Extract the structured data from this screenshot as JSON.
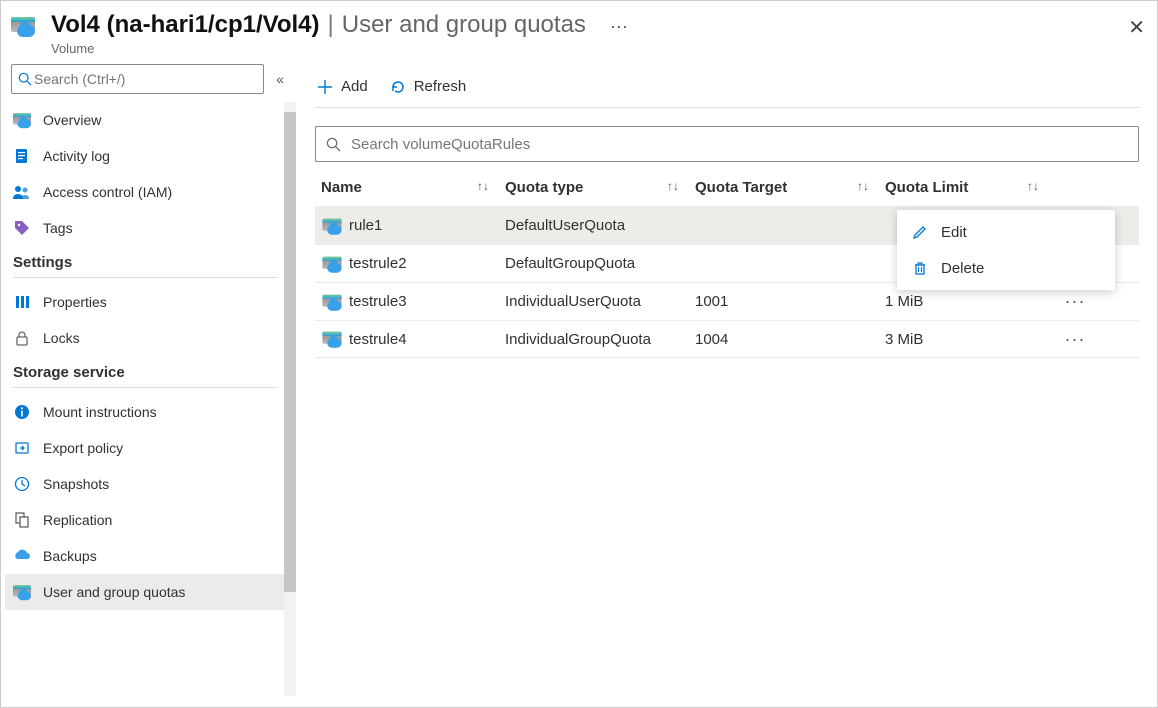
{
  "header": {
    "title_main": "Vol4 (na-hari1/cp1/Vol4)",
    "title_section": "User and group quotas",
    "subtitle": "Volume"
  },
  "sidebar": {
    "search_placeholder": "Search (Ctrl+/)",
    "items_top": [
      {
        "id": "overview",
        "label": "Overview"
      },
      {
        "id": "activity-log",
        "label": "Activity log"
      },
      {
        "id": "iam",
        "label": "Access control (IAM)"
      },
      {
        "id": "tags",
        "label": "Tags"
      }
    ],
    "settings_header": "Settings",
    "items_settings": [
      {
        "id": "properties",
        "label": "Properties"
      },
      {
        "id": "locks",
        "label": "Locks"
      }
    ],
    "storage_header": "Storage service",
    "items_storage": [
      {
        "id": "mount",
        "label": "Mount instructions"
      },
      {
        "id": "export",
        "label": "Export policy"
      },
      {
        "id": "snapshots",
        "label": "Snapshots"
      },
      {
        "id": "replication",
        "label": "Replication"
      },
      {
        "id": "backups",
        "label": "Backups"
      },
      {
        "id": "quotas",
        "label": "User and group quotas"
      }
    ]
  },
  "toolbar": {
    "add_label": "Add",
    "refresh_label": "Refresh"
  },
  "table": {
    "search_placeholder": "Search volumeQuotaRules",
    "columns": {
      "name": "Name",
      "type": "Quota type",
      "target": "Quota Target",
      "limit": "Quota Limit"
    },
    "rows": [
      {
        "name": "rule1",
        "type": "DefaultUserQuota",
        "target": "",
        "limit": ""
      },
      {
        "name": "testrule2",
        "type": "DefaultGroupQuota",
        "target": "",
        "limit": ""
      },
      {
        "name": "testrule3",
        "type": "IndividualUserQuota",
        "target": "1001",
        "limit": "1 MiB"
      },
      {
        "name": "testrule4",
        "type": "IndividualGroupQuota",
        "target": "1004",
        "limit": "3 MiB"
      }
    ]
  },
  "context_menu": {
    "edit": "Edit",
    "delete": "Delete"
  }
}
